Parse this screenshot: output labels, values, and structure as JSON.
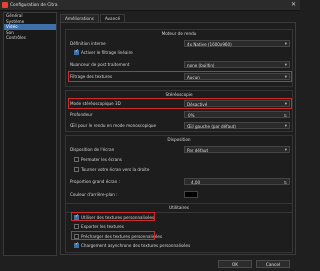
{
  "window": {
    "title": "Configuration de Citra"
  },
  "sidebar": {
    "items": [
      {
        "label": "Général"
      },
      {
        "label": "Système"
      },
      {
        "label": "Vidéo"
      },
      {
        "label": "Son"
      },
      {
        "label": "Contrôles"
      }
    ]
  },
  "tabs": [
    {
      "label": "Améliorations"
    },
    {
      "label": "Avancé"
    }
  ],
  "renderer": {
    "title": "Moteur de rendu",
    "resolution_label": "Définition interne",
    "resolution_value": "4x Native (1600x960)",
    "linear_filter_label": "Activer le filtrage linéaire",
    "shader_label": "Nuanceur de post traitement",
    "shader_value": "none (builtin)",
    "texture_filter_label": "Filtrage des textures",
    "texture_filter_value": "Aucun"
  },
  "stereo": {
    "title": "Stéréoscopie",
    "mode_label": "Mode stéréoscopique 3D",
    "mode_value": "Désactivé",
    "depth_label": "Profondeur",
    "depth_value": "0%",
    "mono_label": "Œil pour le rendu en mode monoscopique",
    "mono_value": "Œil gauche (par défaut)"
  },
  "layout": {
    "title": "Disposition",
    "screen_layout_label": "Disposition de l'écran",
    "screen_layout_value": "Par défaut",
    "swap_screens_label": "Permuter les écrans",
    "rotate_label": "Tourner votre écran vers la droite",
    "proportion_label": "Proportion grand écran :",
    "proportion_value": "4,00",
    "bg_color_label": "Couleur d'arrière-plan :"
  },
  "utilities": {
    "title": "Utilitaires",
    "custom_textures_label": "Utiliser des textures personnalisées",
    "dump_textures_label": "Exporter les textures",
    "preload_textures_label": "Précharger des textures personnalisées",
    "async_loading_label": "Chargement asynchrone des textures personnalisées"
  },
  "footer": {
    "ok_label": "OK",
    "cancel_label": "Cancel"
  },
  "colors": {
    "accent": "#3d6fa8",
    "highlight": "#d12a2a",
    "background": "#1f1f1f"
  },
  "state": {
    "active_sidebar": "Vidéo",
    "active_tab": "Avancé",
    "linear_filter_checked": true,
    "custom_textures_checked": true,
    "dump_textures_checked": false,
    "preload_textures_checked": false,
    "async_loading_checked": true,
    "swap_screens_checked": false,
    "rotate_checked": false
  }
}
